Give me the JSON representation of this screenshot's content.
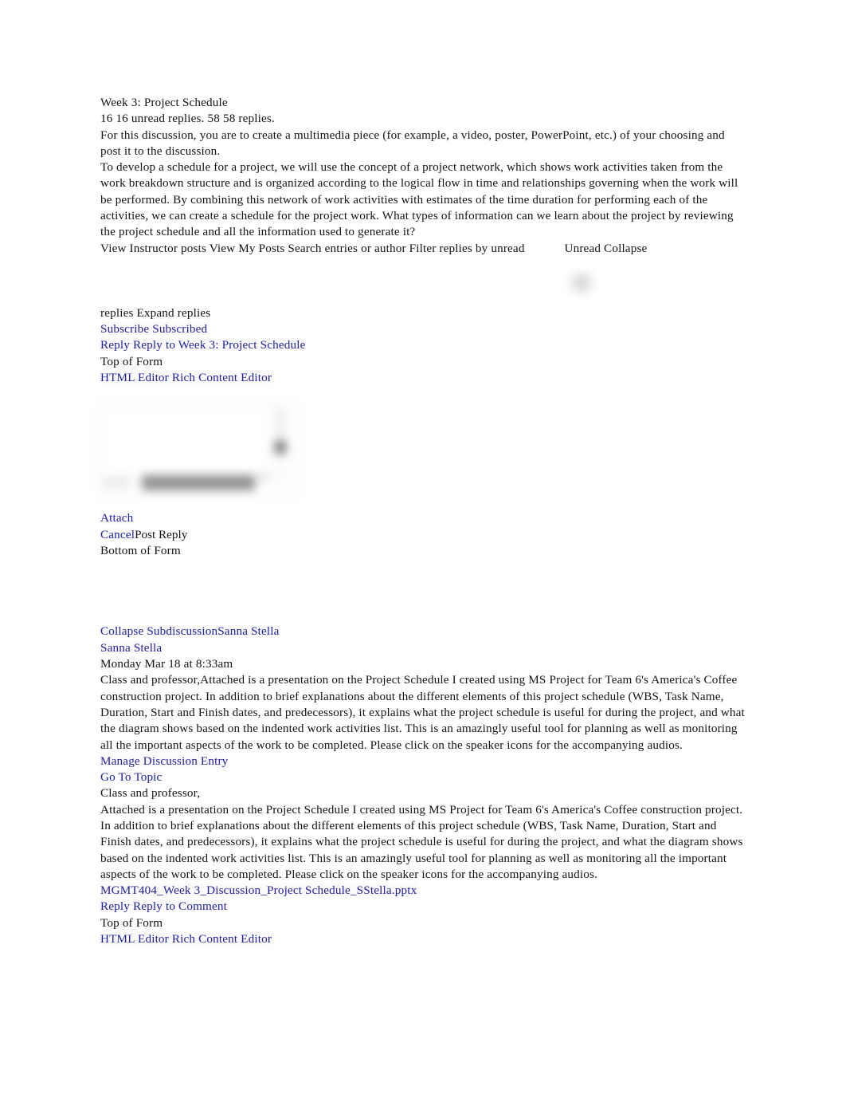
{
  "document": {
    "title": "Week 3: Project Schedule",
    "reply_counts": "16 16 unread replies. 58 58 replies.",
    "prompt_intro": "For this discussion, you are to create a multimedia piece (for example, a video, poster, PowerPoint, etc.) of your choosing and post it to the discussion.",
    "prompt_body": "To develop a schedule for a project, we will use the concept of a project network, which shows work activities taken from the work breakdown structure and is organized according to the logical flow in time and relationships governing when the work will be performed. By combining this network of work activities with estimates of the time duration for performing each of the activities, we can create a schedule for the project work. What types of information can we learn about the project by reviewing the project schedule and all the information used to generate it?",
    "toolbar_line": "View Instructor posts View My Posts Search entries or author Filter replies by unread",
    "toolbar_unread_collapse": "Unread Collapse",
    "expand_replies": "replies Expand replies",
    "subscribe": "Subscribe Subscribed",
    "reply_topic": "Reply Reply to Week 3: Project Schedule",
    "top_of_form": "Top of Form",
    "editor_toggle": "HTML Editor Rich Content Editor",
    "attach": "Attach",
    "cancel": "Cancel",
    "post_reply": "Post Reply",
    "bottom_of_form": "Bottom of Form"
  },
  "reply": {
    "collapse_subdiscussion": "Collapse SubdiscussionSanna Stella",
    "author": "Sanna Stella",
    "timestamp": "Monday Mar 18 at 8:33am",
    "preview": "Class and professor,Attached is a presentation on the Project Schedule I created using MS Project for Team 6's America's Coffee construction project. In addition to brief explanations about the different elements of this project schedule (WBS, Task Name, Duration, Start and Finish dates, and predecessors), it explains what the project schedule is useful for during the project, and what the diagram shows based on the indented work activities list. This is an amazingly useful tool for planning as well as monitoring all the important aspects of the work to be completed. Please click on the speaker icons for the accompanying audios.",
    "manage_entry": "Manage Discussion Entry",
    "go_to_topic": "Go To Topic",
    "salutation": "Class and professor,",
    "body": "Attached is a presentation on the Project Schedule I created using MS Project for Team 6's America's Coffee construction project. In addition to brief explanations about the different elements of this project schedule (WBS, Task Name, Duration, Start and Finish dates, and predecessors), it explains what the project schedule is useful for during the project, and what the diagram shows based on the indented work activities list. This is an amazingly useful tool for planning as well as monitoring all the important aspects of the work to be completed. Please click on the speaker icons for the accompanying audios.",
    "attachment": "MGMT404_Week 3_Discussion_Project Schedule_SStella.pptx",
    "reply_to_comment": "Reply Reply to Comment",
    "top_of_form": "Top of Form",
    "editor_toggle": "HTML Editor Rich Content Editor"
  },
  "colors": {
    "link": "#21219c",
    "text": "#141414",
    "background": "#ffffff"
  }
}
